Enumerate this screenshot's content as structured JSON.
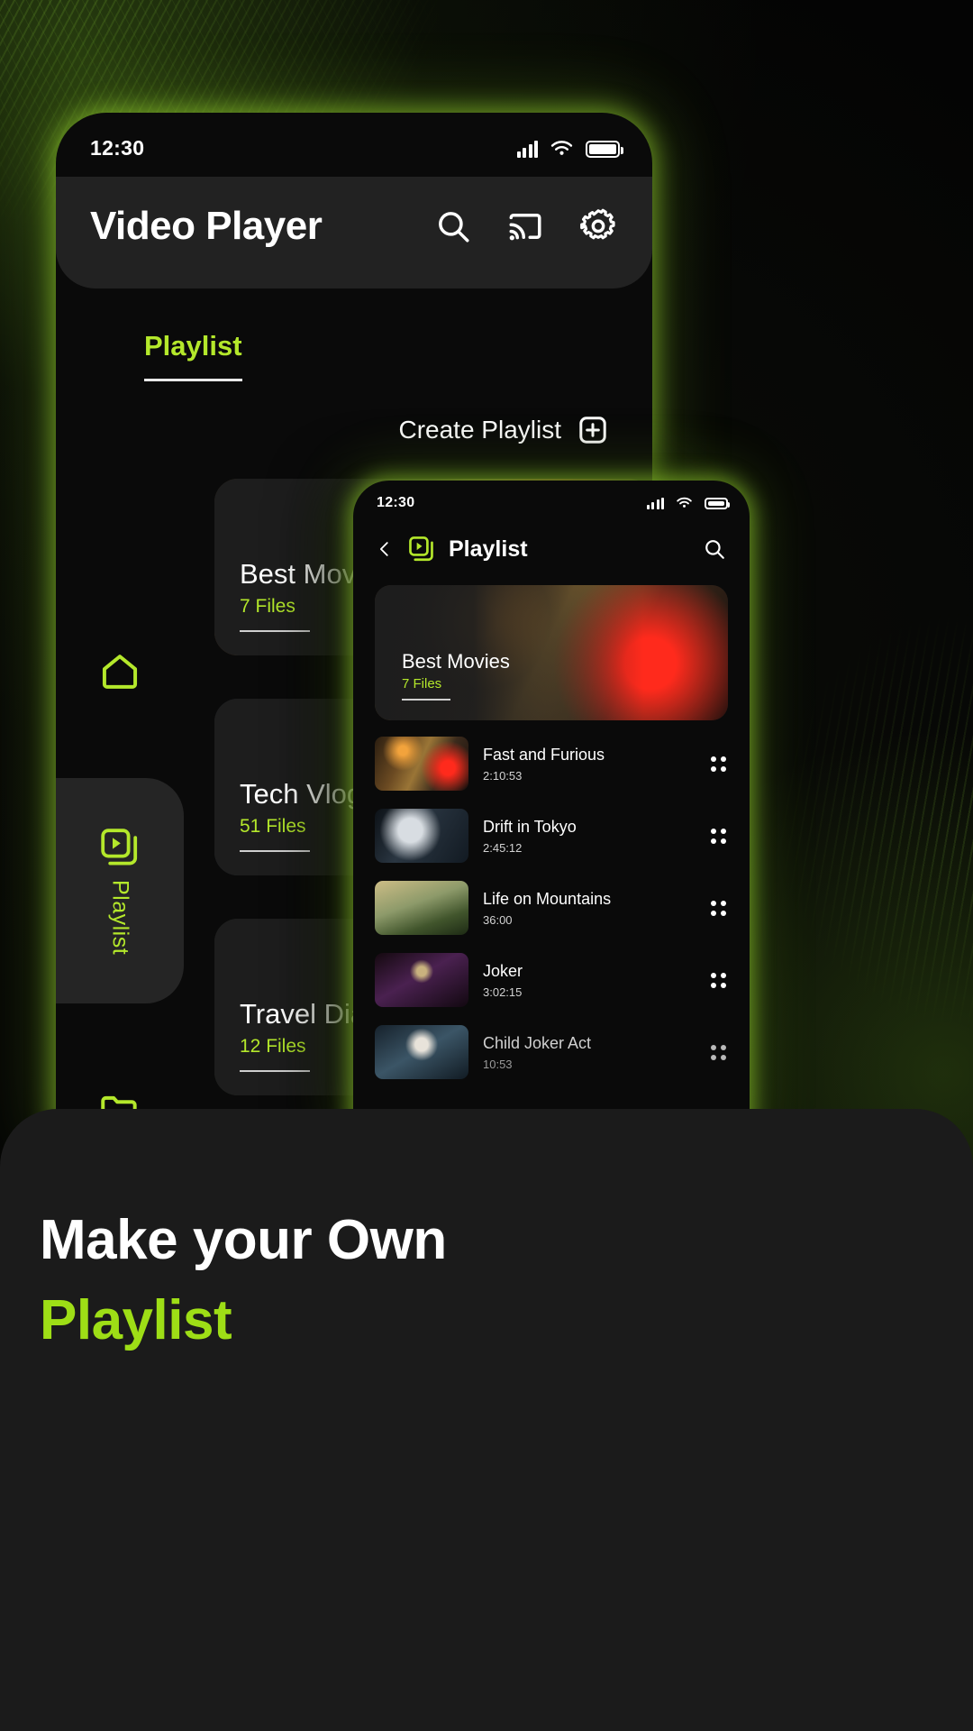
{
  "background": {
    "accent_color": "#b4e82b",
    "dark_bg": "#050505",
    "panel_bg": "#1b1b1b"
  },
  "phone1": {
    "status": {
      "time": "12:30",
      "signal_icon": "signal-bars-icon",
      "wifi_icon": "wifi-icon",
      "battery_icon": "battery-icon"
    },
    "header": {
      "title": "Video Player",
      "actions": [
        {
          "name": "search-icon",
          "label": "Search"
        },
        {
          "name": "cast-icon",
          "label": "Cast"
        },
        {
          "name": "settings-gear-icon",
          "label": "Settings"
        }
      ]
    },
    "tab": {
      "label": "Playlist"
    },
    "create": {
      "label": "Create Playlist",
      "icon": "add-playlist-icon"
    },
    "playlists": [
      {
        "name": "Best Movies",
        "files": "7 Files",
        "art": "art-cars"
      },
      {
        "name": "Tech Vlogs",
        "files": "51 Files",
        "art": "art-tech"
      },
      {
        "name": "Travel Diary",
        "files": "12 Files",
        "art": "art-travel"
      }
    ],
    "rail": [
      {
        "name": "home-icon",
        "label": ""
      },
      {
        "name": "playlist-icon",
        "label": "Playlist"
      },
      {
        "name": "folder-icon",
        "label": ""
      }
    ]
  },
  "phone2": {
    "status": {
      "time": "12:30"
    },
    "header": {
      "back_icon": "back-chevron-icon",
      "logo_icon": "playlist-logo-icon",
      "title": "Playlist",
      "search_icon": "search-icon"
    },
    "hero": {
      "name": "Best Movies",
      "files": "7 Files"
    },
    "videos": [
      {
        "title": "Fast and Furious",
        "duration": "2:10:53",
        "art": "art-cars"
      },
      {
        "title": "Drift in Tokyo",
        "duration": "2:45:12",
        "art": "art-drift"
      },
      {
        "title": "Life on Mountains",
        "duration": "36:00",
        "art": "art-mount"
      },
      {
        "title": "Joker",
        "duration": "3:02:15",
        "art": "art-joker"
      },
      {
        "title": "Child Joker Act",
        "duration": "10:53",
        "art": "art-child"
      }
    ]
  },
  "tagline": {
    "line1": "Make your Own",
    "line2": "Playlist"
  }
}
